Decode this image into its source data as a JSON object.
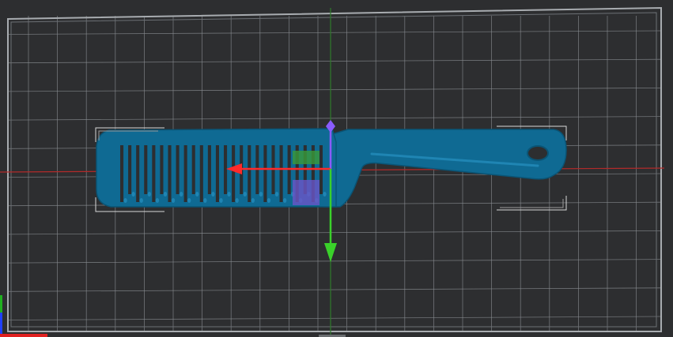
{
  "scene": {
    "object_name": "",
    "background_color": "#2d2e30",
    "grid_color": "#8a8d91",
    "bed_border_color": "#a8acb0",
    "model_color": "#0f6a93",
    "model_edge_color": "#0a5475",
    "model_highlight_color": "#1f85b3",
    "x_axis_color": "#ff2a2a",
    "y_axis_color": "#3ad12a",
    "z_axis_color": "#8a5cff",
    "bounding_box_color": "#d8d8d8",
    "grid": true
  },
  "gizmo": {
    "arrows": [
      {
        "name": "x-axis-arrow",
        "direction": "left",
        "color": "#ff2a2a"
      },
      {
        "name": "y-axis-arrow",
        "direction": "down",
        "color": "#3ad12a"
      },
      {
        "name": "z-axis-handle",
        "direction": "up",
        "color": "#8a5cff"
      }
    ],
    "planes": [
      {
        "name": "xy-plane-handle",
        "color": "#3a9a3a"
      },
      {
        "name": "yz-plane-handle",
        "color": "#6a55c8"
      }
    ]
  },
  "corner_axes": {
    "x_color": "#e02020",
    "y_color": "#20b020",
    "z_color": "#2040ff"
  }
}
